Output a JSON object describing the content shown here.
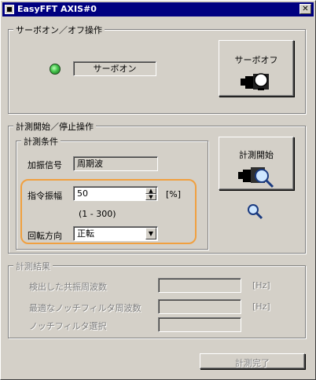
{
  "window": {
    "title": "EasyFFT AXIS#0",
    "close_glyph": "✕"
  },
  "servo": {
    "group_label": "サーボオン／オフ操作",
    "status_text": "サーボオン",
    "off_button_label": "サーボオフ"
  },
  "measure": {
    "group_label": "計測開始／停止操作",
    "conditions_label": "計測条件",
    "excitation_label": "加振信号",
    "excitation_value": "周期波",
    "amplitude_label": "指令振幅",
    "amplitude_value": "50",
    "amplitude_unit": "[%]",
    "amplitude_range": "(1 - 300)",
    "direction_label": "回転方向",
    "direction_value": "正転",
    "start_button_label": "計測開始"
  },
  "results": {
    "group_label": "計測結果",
    "resonance_label": "検出した共振周波数",
    "resonance_unit": "[Hz]",
    "notch_freq_label": "最適なノッチフィルタ周波数",
    "notch_freq_unit": "[Hz]",
    "notch_select_label": "ノッチフィルタ選択"
  },
  "footer": {
    "complete_button_label": "計測完了"
  },
  "colors": {
    "face": "#d4d0c8",
    "titlebar": "#000080",
    "highlight": "#f0a040",
    "led": "#42c24a"
  },
  "icons": [
    "window-icon",
    "close-icon",
    "servo-status-led",
    "motor-power-icon",
    "motor-magnifier-icon",
    "magnifier-icon",
    "spin-up-icon",
    "spin-down-icon",
    "dropdown-arrow-icon"
  ]
}
